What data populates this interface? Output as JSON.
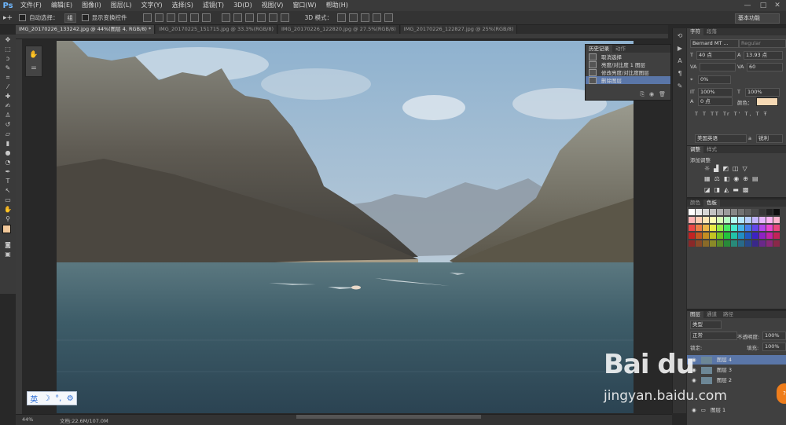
{
  "menubar": {
    "logo": "Ps",
    "items": [
      "文件(F)",
      "编辑(E)",
      "图像(I)",
      "图层(L)",
      "文字(Y)",
      "选择(S)",
      "滤镜(T)",
      "3D(D)",
      "视图(V)",
      "窗口(W)",
      "帮助(H)"
    ],
    "window_controls": [
      "—",
      "□",
      "✕"
    ]
  },
  "options": {
    "auto_select_label": "自动选择：",
    "auto_select_value": "组",
    "show_transform_label": "显示变换控件",
    "mode_3d_label": "3D 模式：",
    "workspace": "基本功能"
  },
  "tabs": [
    {
      "label": "IMG_20170226_133242.jpg @ 44%(图层 4, RGB/8) *",
      "active": true
    },
    {
      "label": "IMG_20170225_151715.jpg @ 33.3%(RGB/8)",
      "active": false
    },
    {
      "label": "IMG_20170226_122820.jpg @ 27.5%(RGB/8)",
      "active": false
    },
    {
      "label": "IMG_20170226_122827.jpg @ 25%(RGB/8)",
      "active": false
    }
  ],
  "toolbar": {
    "tools": [
      "move-icon",
      "marquee-icon",
      "lasso-icon",
      "quick-select-icon",
      "crop-icon",
      "eyedropper-icon",
      "healing-icon",
      "brush-icon",
      "stamp-icon",
      "history-brush-icon",
      "eraser-icon",
      "gradient-icon",
      "blur-icon",
      "dodge-icon",
      "pen-icon",
      "type-icon",
      "path-select-icon",
      "shape-icon",
      "hand-icon",
      "zoom-icon"
    ]
  },
  "history_panel": {
    "tab_history": "历史记录",
    "tab_actions": "动作",
    "items": [
      {
        "label": "取消选择",
        "selected": false
      },
      {
        "label": "亮度/对比度 1 图层",
        "selected": false
      },
      {
        "label": "修改亮度/对比度图层",
        "selected": false
      },
      {
        "label": "删除图层",
        "selected": true
      }
    ]
  },
  "character_panel": {
    "tab": "字符",
    "tab2": "段落",
    "font_family": "Bernard MT ...",
    "font_style": "Regular",
    "font_size": "40 点",
    "leading": "13.93 点",
    "kerning": "VA",
    "tracking": "60",
    "scale_pct": "0%",
    "vertical_scale": "100%",
    "horizontal_scale": "100%",
    "baseline": "0 点",
    "color_label": "颜色：",
    "language": "美国英语",
    "antialias_label": "a",
    "antialias": "锐利",
    "style_glyphs": "T T TT Tr T' T, T Ŧ"
  },
  "adjustments_panel": {
    "tab": "调整",
    "tab2": "样式",
    "title": "添加调整"
  },
  "swatches_panel": {
    "tab": "颜色",
    "tab2": "色板"
  },
  "layers_panel": {
    "tabs": [
      "图层",
      "通道",
      "路径"
    ],
    "filter": "类型",
    "blend_mode": "正常",
    "opacity_label": "不透明度:",
    "opacity": "100%",
    "lock_label": "锁定:",
    "fill_label": "填充:",
    "fill": "100%",
    "layers": [
      "图层 4",
      "图层 3",
      "图层 2",
      "图层 1"
    ]
  },
  "status": {
    "zoom": "44%",
    "doc_info": "文档:22.6M/107.0M"
  },
  "ime": {
    "lang": "英",
    "icons": [
      "moon-icon",
      "comma-icon",
      "gear-icon"
    ]
  },
  "watermark": {
    "main": "Bai du",
    "sub": "jingyan.baidu.com"
  },
  "colors": {
    "ui_bg": "#282828",
    "panel_bg": "#404040",
    "selection": "#5a76a8",
    "foreground_color": "#f2c89a",
    "text_color_swatch": "#f6d9b4"
  }
}
